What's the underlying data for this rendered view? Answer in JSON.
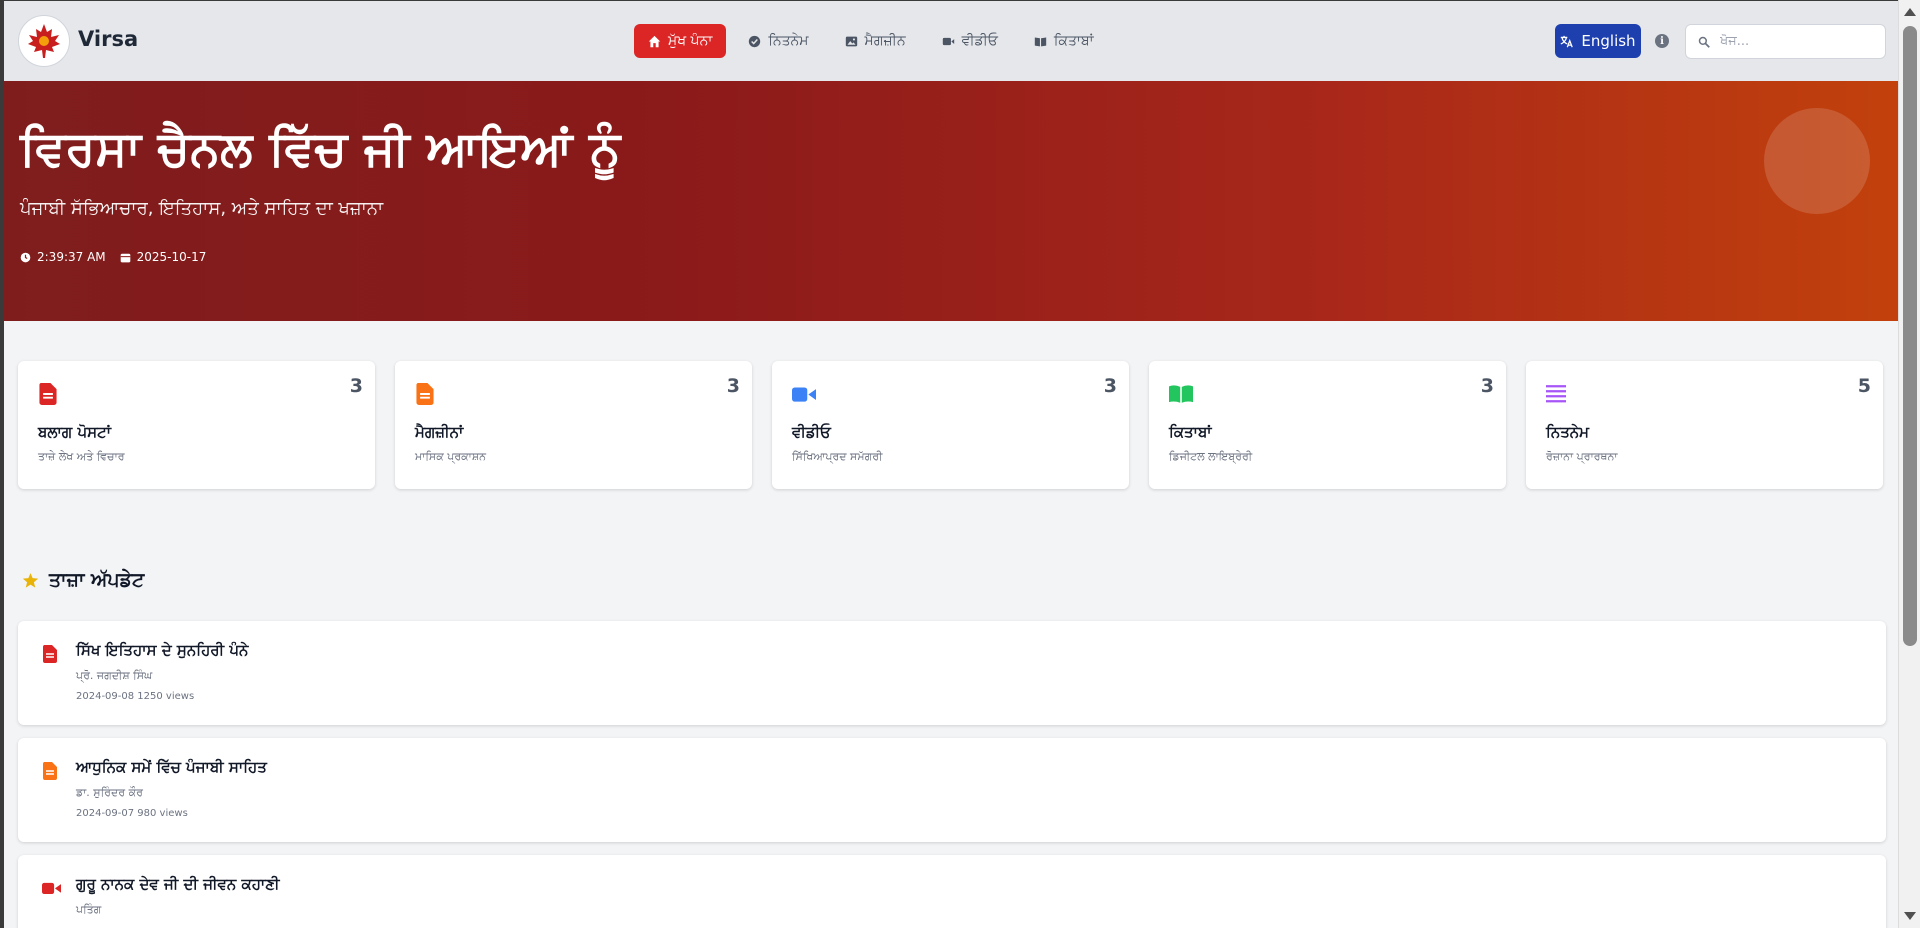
{
  "header": {
    "brand": "Virsa",
    "nav": [
      {
        "label": "ਮੁੱਖ ਪੰਨਾ",
        "icon": "home-icon",
        "active": true
      },
      {
        "label": "ਨਿਤਨੇਮ",
        "icon": "check-circle-icon",
        "active": false
      },
      {
        "label": "ਮੈਗਜ਼ੀਨ",
        "icon": "image-icon",
        "active": false
      },
      {
        "label": "ਵੀਡੀਓ",
        "icon": "video-icon",
        "active": false
      },
      {
        "label": "ਕਿਤਾਬਾਂ",
        "icon": "book-icon",
        "active": false
      }
    ],
    "language_label": "English",
    "search_placeholder": "ਖੋਜ..."
  },
  "hero": {
    "title": "ਵਿਰਸਾ ਚੈਨਲ ਵਿੱਚ ਜੀ ਆਇਆਂ ਨੂੰ",
    "subtitle": "ਪੰਜਾਬੀ ਸੱਭਿਆਚਾਰ, ਇਤਿਹਾਸ, ਅਤੇ ਸਾਹਿਤ ਦਾ ਖਜ਼ਾਨਾ",
    "time": "2:39:37 AM",
    "date": "2025-10-17"
  },
  "cards": [
    {
      "title": "ਬਲਾਗ ਪੋਸਟਾਂ",
      "subtitle": "ਤਾਜ਼ੇ ਲੇਖ ਅਤੇ ਵਿਚਾਰ",
      "count": "3",
      "icon": "document-icon",
      "color": "#dc2626"
    },
    {
      "title": "ਮੈਗਜ਼ੀਨਾਂ",
      "subtitle": "ਮਾਸਿਕ ਪ੍ਰਕਾਸ਼ਨ",
      "count": "3",
      "icon": "document-icon",
      "color": "#f97316"
    },
    {
      "title": "ਵੀਡੀਓ",
      "subtitle": "ਸਿੱਖਿਆਪ੍ਰਦ ਸਮੱਗਰੀ",
      "count": "3",
      "icon": "video-icon",
      "color": "#3b82f6"
    },
    {
      "title": "ਕਿਤਾਬਾਂ",
      "subtitle": "ਡਿਜੀਟਲ ਲਾਇਬ੍ਰੇਰੀ",
      "count": "3",
      "icon": "book-open-icon",
      "color": "#22c55e"
    },
    {
      "title": "ਨਿਤਨੇਮ",
      "subtitle": "ਰੋਜ਼ਾਨਾ ਪ੍ਰਾਰਥਨਾ",
      "count": "5",
      "icon": "list-icon",
      "color": "#a855f7"
    }
  ],
  "updates": {
    "heading": "ਤਾਜ਼ਾ ਅੱਪਡੇਟ",
    "items": [
      {
        "title": "ਸਿੱਖ ਇਤਿਹਾਸ ਦੇ ਸੁਨਹਿਰੀ ਪੰਨੇ",
        "author": "ਪ੍ਰੋ. ਜਗਦੀਸ਼ ਸਿੰਘ",
        "meta": "2024-09-08 1250 views",
        "icon": "document-icon",
        "color": "#dc2626"
      },
      {
        "title": "ਆਧੁਨਿਕ ਸਮੇਂ ਵਿੱਚ ਪੰਜਾਬੀ ਸਾਹਿਤ",
        "author": "ਡਾ. ਸੁਰਿੰਦਰ ਕੌਰ",
        "meta": "2024-09-07 980 views",
        "icon": "document-icon",
        "color": "#f97316"
      },
      {
        "title": "ਗੁਰੂ ਨਾਨਕ ਦੇਵ ਜੀ ਦੀ ਜੀਵਨ ਕਹਾਣੀ",
        "author": "ਪਤਿੰਗ",
        "meta": "",
        "icon": "video-icon",
        "color": "#dc2626"
      }
    ]
  }
}
